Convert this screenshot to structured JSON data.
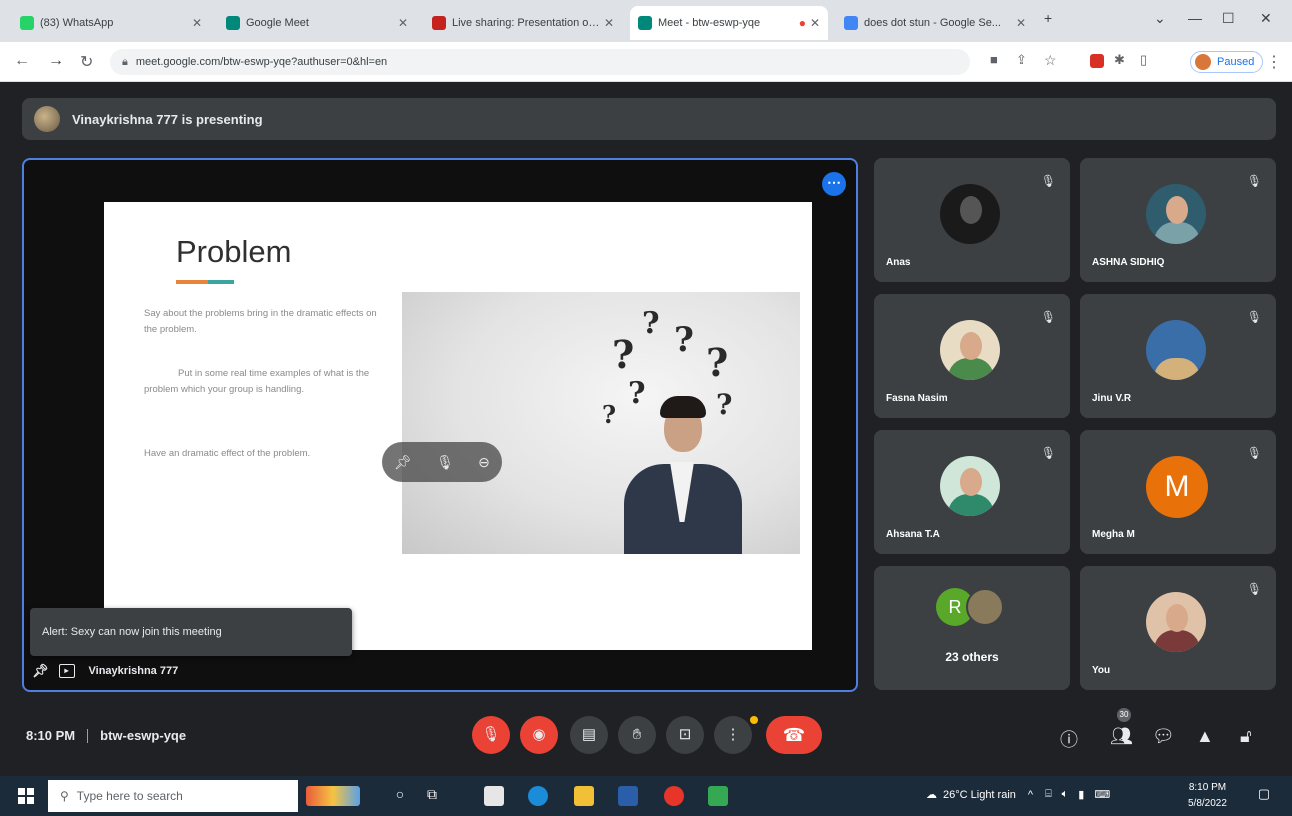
{
  "browser": {
    "tabs": [
      {
        "title": "(83) WhatsApp",
        "favicon_color": "#25d366"
      },
      {
        "title": "Google Meet",
        "favicon_color": "#00897b"
      },
      {
        "title": "Live sharing: Presentation of ...",
        "favicon_color": "#c5221f"
      },
      {
        "title": "Meet - btw-eswp-yqe",
        "favicon_color": "#00897b"
      },
      {
        "title": "does dot stun - Google Se...",
        "favicon_color": "#4285f4"
      }
    ],
    "new_tab_label": "+",
    "url": "meet.google.com/btw-eswp-yqe?authuser=0&hl=en",
    "profile_label": "Paused"
  },
  "meet": {
    "presenting_banner": "Vinaykrishna 777 is presenting",
    "slide": {
      "title": "Problem",
      "paragraph1": "Say about the problems bring in the dramatic effects on the problem.",
      "paragraph2": "Put in some real time examples of what is the problem which your group is handling.",
      "paragraph3": "Have an dramatic effect of the problem."
    },
    "toast": "Alert: Sexy can now join this meeting",
    "presenter_name": "Vinaykrishna 777",
    "participants": [
      {
        "name": "Anas",
        "colors": [
          "#1a1a1a",
          "#555555"
        ]
      },
      {
        "name": "ASHNA SIDHIQ",
        "colors": [
          "#2f5d6e",
          "#7aa0a8"
        ]
      },
      {
        "name": "Fasna Nasim",
        "colors": [
          "#4a8a4a",
          "#e8dcc4"
        ]
      },
      {
        "name": "Jinu V.R",
        "colors": [
          "#3a6ea8",
          "#d4b07a"
        ]
      },
      {
        "name": "Ahsana T.A",
        "colors": [
          "#2e8a6a",
          "#cfe6d9"
        ]
      },
      {
        "name": "Megha M",
        "letter": "M",
        "bg": "#e8710a"
      },
      {
        "name": "You",
        "colors": [
          "#7a3a3a",
          "#e0c2a8"
        ]
      }
    ],
    "others": {
      "letter": "R",
      "label": "23 others"
    },
    "meeting_time": "8:10 PM",
    "meeting_code": "btw-eswp-yqe",
    "people_count": "30"
  },
  "taskbar": {
    "search_placeholder": "Type here to search",
    "weather": "26°C Light rain",
    "time": "8:10 PM",
    "date": "5/8/2022"
  }
}
